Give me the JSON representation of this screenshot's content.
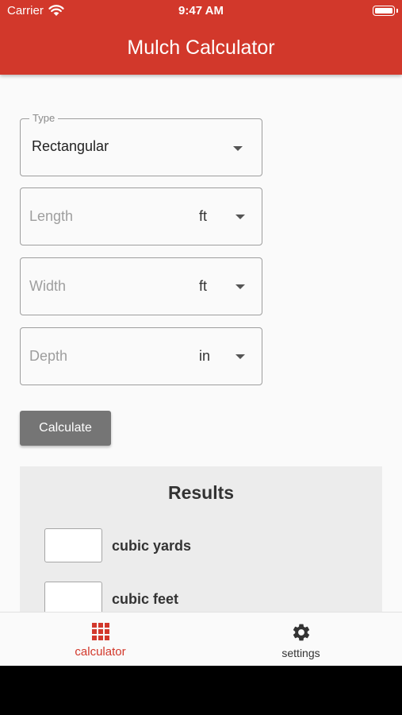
{
  "status_bar": {
    "carrier": "Carrier",
    "time": "9:47 AM"
  },
  "app_bar": {
    "title": "Mulch Calculator"
  },
  "form": {
    "type": {
      "label": "Type",
      "value": "Rectangular"
    },
    "length": {
      "placeholder": "Length",
      "unit": "ft"
    },
    "width": {
      "placeholder": "Width",
      "unit": "ft"
    },
    "depth": {
      "placeholder": "Depth",
      "unit": "in"
    },
    "calculate_label": "Calculate"
  },
  "results": {
    "title": "Results",
    "rows": [
      {
        "unit": "cubic yards",
        "value": ""
      },
      {
        "unit": "cubic feet",
        "value": ""
      }
    ]
  },
  "bottom_nav": {
    "items": [
      {
        "label": "calculator",
        "icon": "grid-icon",
        "active": true
      },
      {
        "label": "settings",
        "icon": "gear-icon",
        "active": false
      }
    ]
  },
  "colors": {
    "primary": "#d2382b",
    "button": "#757575",
    "results_bg": "#ececec"
  }
}
